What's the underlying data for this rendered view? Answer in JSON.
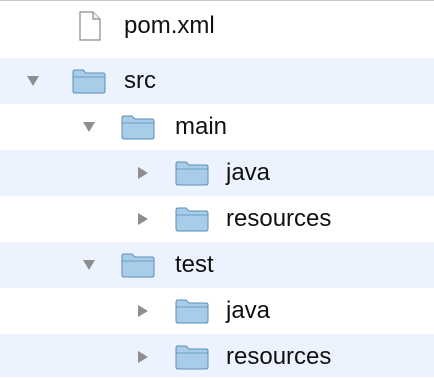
{
  "tree": {
    "items": [
      {
        "label": "pom.xml",
        "kind": "file",
        "disclosure": "none"
      },
      {
        "label": "src",
        "kind": "folder",
        "disclosure": "expanded"
      },
      {
        "label": "main",
        "kind": "folder",
        "disclosure": "expanded"
      },
      {
        "label": "java",
        "kind": "folder",
        "disclosure": "collapsed"
      },
      {
        "label": "resources",
        "kind": "folder",
        "disclosure": "collapsed"
      },
      {
        "label": "test",
        "kind": "folder",
        "disclosure": "expanded"
      },
      {
        "label": "java",
        "kind": "folder",
        "disclosure": "collapsed"
      },
      {
        "label": "resources",
        "kind": "folder",
        "disclosure": "collapsed"
      }
    ]
  },
  "colors": {
    "row_alt_background": "#edf3fe",
    "disclosure_triangle": "#8e8e8e",
    "folder_fill": "#a8cde8",
    "folder_stroke": "#5a8fb8"
  }
}
